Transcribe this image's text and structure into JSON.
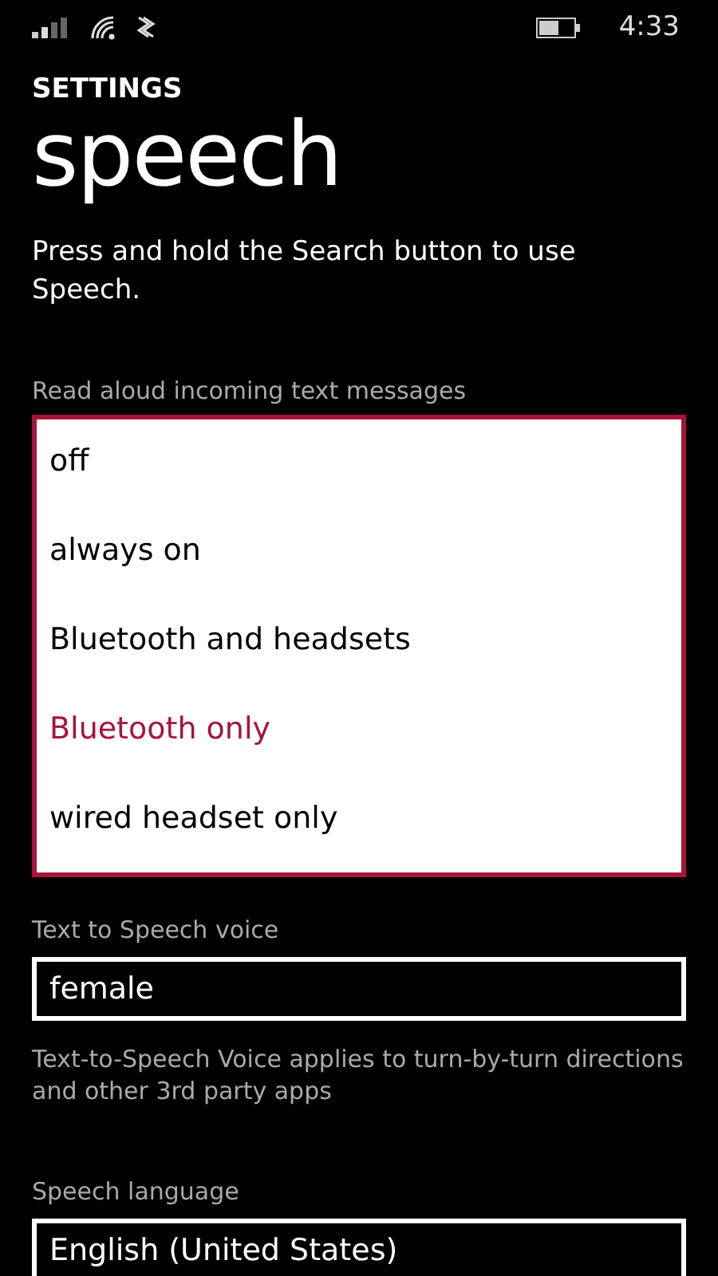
{
  "status_bar": {
    "time": "4:33"
  },
  "header": {
    "section": "SETTINGS",
    "title": "speech"
  },
  "description": "Press and hold the Search button to use Speech.",
  "read_aloud": {
    "label": "Read aloud incoming text messages",
    "expanded": true,
    "options": [
      {
        "label": "off",
        "selected": false
      },
      {
        "label": "always on",
        "selected": false
      },
      {
        "label": "Bluetooth and headsets",
        "selected": false
      },
      {
        "label": "Bluetooth only",
        "selected": true
      },
      {
        "label": "wired headset only",
        "selected": false
      }
    ]
  },
  "voice": {
    "label": "Text to Speech voice",
    "value": "female",
    "help": "Text-to-Speech Voice applies to turn-by-turn directions and other 3rd party apps"
  },
  "language": {
    "label": "Speech language",
    "value": "English (United States)"
  }
}
